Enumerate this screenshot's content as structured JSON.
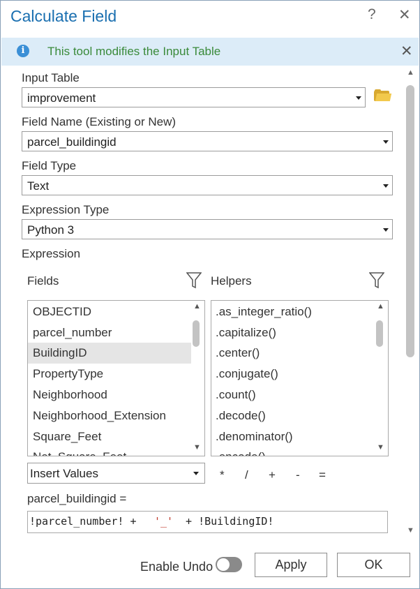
{
  "window": {
    "title": "Calculate Field",
    "help": "?",
    "close": "✕"
  },
  "info": {
    "message": "This tool modifies the Input Table",
    "icon": "info-icon",
    "close": "✕"
  },
  "input_table": {
    "label": "Input Table",
    "value": "improvement"
  },
  "field_name": {
    "label": "Field Name (Existing or New)",
    "value": "parcel_buildingid"
  },
  "field_type": {
    "label": "Field Type",
    "value": "Text"
  },
  "expression_type": {
    "label": "Expression Type",
    "value": "Python 3"
  },
  "expression": {
    "label": "Expression",
    "fields_label": "Fields",
    "helpers_label": "Helpers",
    "fields": [
      "OBJECTID",
      "parcel_number",
      "BuildingID",
      "PropertyType",
      "Neighborhood",
      "Neighborhood_Extension",
      "Square_Feet",
      "Net_Square_Feet"
    ],
    "selected_field": "BuildingID",
    "helpers": [
      ".as_integer_ratio()",
      ".capitalize()",
      ".center()",
      ".conjugate()",
      ".count()",
      ".decode()",
      ".denominator()",
      ".encode()"
    ],
    "insert_values": "Insert Values",
    "operators": [
      "*",
      "/",
      "+",
      "-",
      "="
    ],
    "target": "parcel_buildingid =",
    "code": {
      "part1": "!parcel_number! + ",
      "part2": "'_'",
      "part3": " + !BuildingID!"
    }
  },
  "footer": {
    "enable_undo": "Enable Undo",
    "apply": "Apply",
    "ok": "OK"
  },
  "colors": {
    "title": "#1a6fb0",
    "info_bg": "#dcecf8",
    "info_text": "#3a8a3a",
    "string_literal": "#c0392b",
    "selected_row": "#e5e5e5"
  }
}
